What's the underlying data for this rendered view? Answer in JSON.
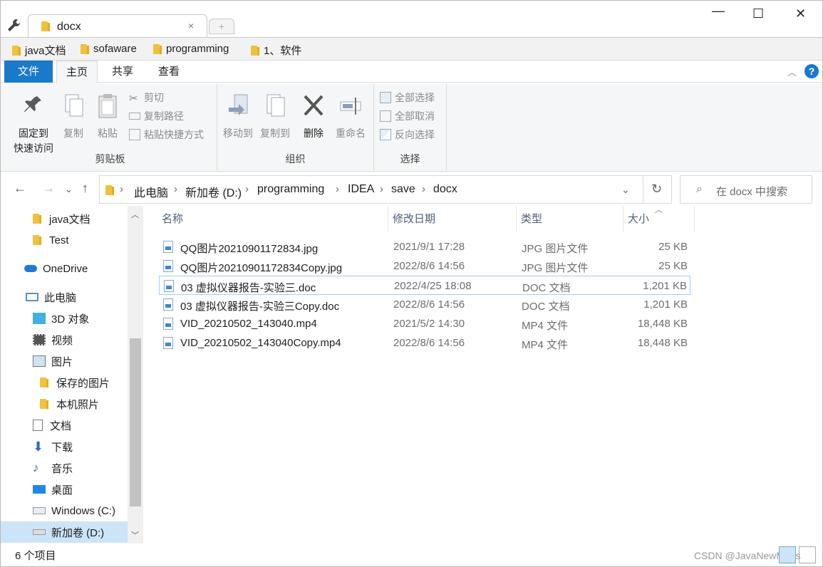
{
  "titlebar": {
    "tab_title": "docx",
    "close_tab": "×",
    "new_tab": "+",
    "minimize": "—",
    "maximize": "☐",
    "close": "✕"
  },
  "bookmarks": [
    "java文档",
    "sofaware",
    "programming",
    "1、软件"
  ],
  "ribbon_tabs": {
    "file": "文件",
    "home": "主页",
    "share": "共享",
    "view": "查看"
  },
  "ribbon": {
    "clipboard": {
      "pin": "固定到快速访问",
      "pin1": "固定到",
      "pin2": "快速访问",
      "copy": "复制",
      "paste": "粘贴",
      "cut": "剪切",
      "copy_path": "复制路径",
      "paste_shortcut": "粘贴快捷方式",
      "label": "剪贴板"
    },
    "organize": {
      "move_to": "移动到",
      "copy_to": "复制到",
      "delete": "删除",
      "rename": "重命名",
      "label": "组织"
    },
    "select": {
      "select_all": "全部选择",
      "select_none": "全部取消",
      "invert": "反向选择",
      "label": "选择"
    }
  },
  "address": {
    "crumbs": [
      "此电脑",
      "新加卷 (D:)",
      "programming",
      "IDEA",
      "save",
      "docx"
    ]
  },
  "search": {
    "placeholder": "在 docx 中搜索"
  },
  "nav": [
    "java文档",
    "Test",
    "OneDrive",
    "此电脑",
    "3D 对象",
    "视频",
    "图片",
    "保存的图片",
    "本机照片",
    "文档",
    "下载",
    "音乐",
    "桌面",
    "Windows (C:)",
    "新加卷 (D:)"
  ],
  "columns": {
    "name": "名称",
    "date": "修改日期",
    "type": "类型",
    "size": "大小"
  },
  "files": [
    {
      "name": "QQ图片20210901172834.jpg",
      "date": "2021/9/1 17:28",
      "type": "JPG 图片文件",
      "size": "25 KB"
    },
    {
      "name": "QQ图片20210901172834Copy.jpg",
      "date": "2022/8/6 14:56",
      "type": "JPG 图片文件",
      "size": "25 KB"
    },
    {
      "name": "03 虚拟仪器报告-实验三.doc",
      "date": "2022/4/25 18:08",
      "type": "DOC 文档",
      "size": "1,201 KB"
    },
    {
      "name": "03 虚拟仪器报告-实验三Copy.doc",
      "date": "2022/8/6 14:56",
      "type": "DOC 文档",
      "size": "1,201 KB"
    },
    {
      "name": "VID_20210502_143040.mp4",
      "date": "2021/5/2 14:30",
      "type": "MP4 文件",
      "size": "18,448 KB"
    },
    {
      "name": "VID_20210502_143040Copy.mp4",
      "date": "2022/8/6 14:56",
      "type": "MP4 文件",
      "size": "18,448 KB"
    }
  ],
  "status": {
    "count": "6 个项目"
  },
  "watermark": "CSDN @JavaNewMans"
}
